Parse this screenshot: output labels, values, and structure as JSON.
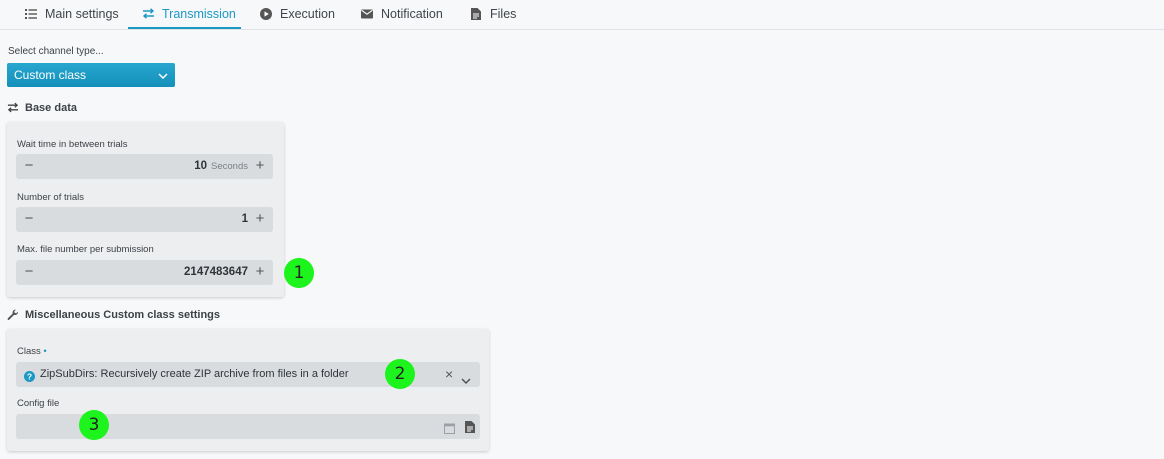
{
  "tabs": [
    {
      "label": "Main settings",
      "icon": "list-icon",
      "active": false
    },
    {
      "label": "Transmission",
      "icon": "transfer-arrows-icon",
      "active": true
    },
    {
      "label": "Execution",
      "icon": "play-circle-icon",
      "active": false
    },
    {
      "label": "Notification",
      "icon": "envelope-icon",
      "active": false
    },
    {
      "label": "Files",
      "icon": "file-icon",
      "active": false
    }
  ],
  "channel": {
    "prompt": "Select channel type...",
    "selected": "Custom class"
  },
  "base_data": {
    "title": "Base data",
    "wait_time": {
      "label": "Wait time in between trials",
      "value": "10",
      "unit": "Seconds"
    },
    "trials": {
      "label": "Number of trials",
      "value": "1"
    },
    "max_files": {
      "label": "Max. file number per submission",
      "value": "2147483647"
    }
  },
  "misc": {
    "title": "Miscellaneous Custom class settings",
    "class_label": "Class",
    "class_required_mark": "•",
    "class_value": "ZipSubDirs: Recursively create ZIP archive from files in a folder",
    "config_label": "Config file",
    "config_value": ""
  },
  "markers": [
    "1",
    "2",
    "3"
  ],
  "colors": {
    "accent": "#1b98c4",
    "marker": "#1df41d"
  }
}
